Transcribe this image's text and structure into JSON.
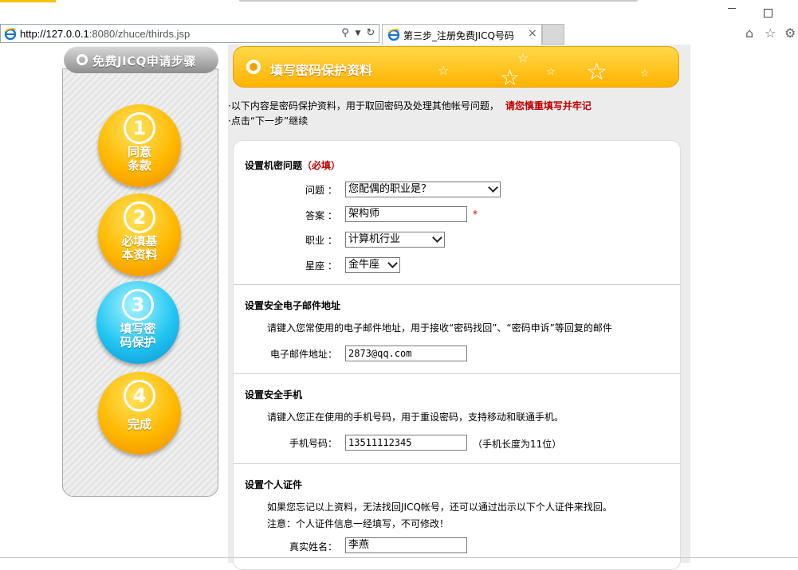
{
  "browser": {
    "url_host": "http://127.0.0.1",
    "url_rest": ":8080/zhuce/thirds.jsp",
    "tab_title": "第三步_注册免费JICQ号码",
    "tab_close": "×"
  },
  "sidebar": {
    "title": "免费JICQ申请步骤",
    "steps": [
      {
        "num": "1",
        "label": "同意\n条款"
      },
      {
        "num": "2",
        "label": "必填基\n本资料"
      },
      {
        "num": "3",
        "label": "填写密\n码保护"
      },
      {
        "num": "4",
        "label": "完成"
      }
    ]
  },
  "banner": {
    "title": "填写密码保护资料"
  },
  "notes": {
    "line1": "·以下内容是密码保护资料，用于取回密码及处理其他帐号问题，",
    "line1_red": "请您慎重填写并牢记",
    "line2": "·点击“下一步”继续"
  },
  "secret": {
    "title": "设置机密问题",
    "required": "（必填）",
    "question_label": "问题 ：",
    "question_value": "您配偶的职业是？",
    "answer_label": "答案 ：",
    "answer_value": "架构师",
    "answer_required_mark": "*",
    "job_label": "职业 ：",
    "job_value": "计算机行业",
    "zodiac_label": "星座 ：",
    "zodiac_value": "金牛座"
  },
  "email": {
    "title": "设置安全电子邮件地址",
    "desc": "请键入您常使用的电子邮件地址，用于接收“密码找回”、“密码申诉”等回复的邮件",
    "label": "电子邮件地址：",
    "value": "2873@qq.com"
  },
  "phone": {
    "title": "设置安全手机",
    "desc": "请键入您正在使用的手机号码，用于重设密码，支持移动和联通手机。",
    "label": "手机号码：",
    "value": "13511112345",
    "hint": "（手机长度为11位）"
  },
  "id": {
    "title": "设置个人证件",
    "desc1": "如果您忘记以上资料，无法找回JICQ帐号，还可以通过出示以下个人证件来找回。",
    "desc2": "注意：个人证件信息一经填写，不可修改！",
    "name_label": "真实姓名：",
    "name_value": "李燕"
  },
  "colors": {
    "accent_orange": "#ffb300",
    "required_red": "#c00000",
    "step_active_blue": "#22c6f2"
  }
}
